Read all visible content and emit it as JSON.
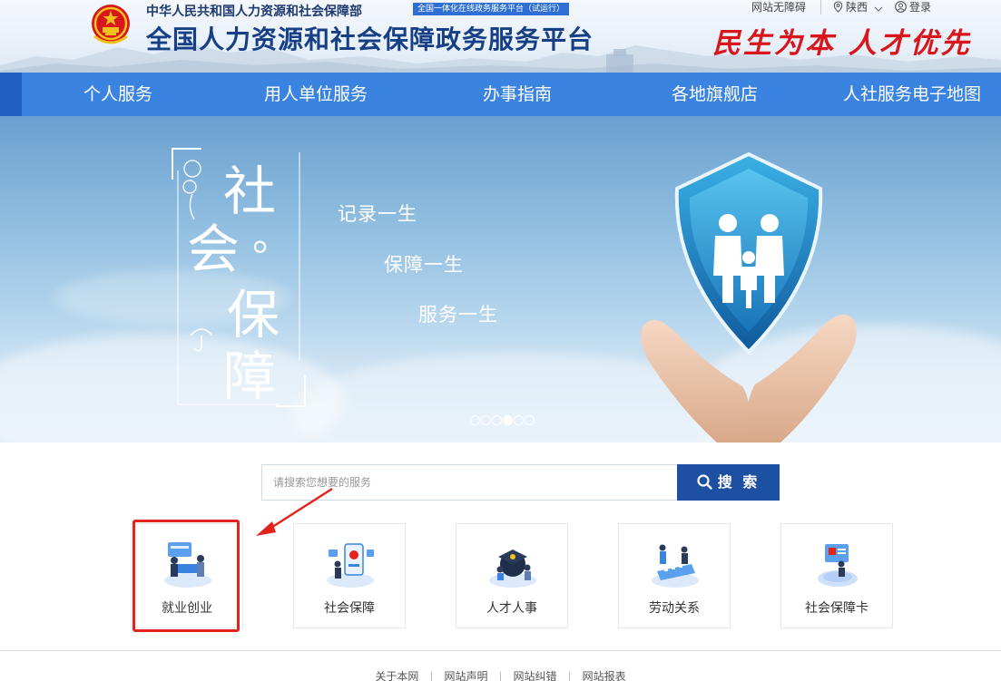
{
  "header": {
    "ministry": "中华人民共和国人力资源和社会保障部",
    "beta_tag": "全国一体化在线政务服务平台（试运行）",
    "platform_title": "全国人力资源和社会保障政务服务平台",
    "slogan": "民生为本 人才优先",
    "accessibility": "网站无障碍",
    "region": "陕西",
    "login": "登录"
  },
  "nav": {
    "items": [
      "个人服务",
      "用人单位服务",
      "办事指南",
      "各地旗舰店",
      "人社服务电子地图"
    ]
  },
  "banner": {
    "chars": [
      "社",
      "会",
      "。",
      "保",
      "障"
    ],
    "phrases": [
      "记录一生",
      "保障一生",
      "服务一生"
    ],
    "active_slide": 4,
    "slide_count": 6
  },
  "search": {
    "placeholder": "请搜索您想要的服务",
    "button_label": "搜 索"
  },
  "services": [
    {
      "label": "就业创业",
      "highlighted": true
    },
    {
      "label": "社会保障",
      "highlighted": false
    },
    {
      "label": "人才人事",
      "highlighted": false
    },
    {
      "label": "劳动关系",
      "highlighted": false
    },
    {
      "label": "社会保障卡",
      "highlighted": false
    }
  ],
  "footer": {
    "links": [
      "关于本网",
      "网站声明",
      "网站纠错",
      "网站报表"
    ]
  },
  "colors": {
    "nav_blue": "#3a83e0",
    "title_navy": "#163f86",
    "slogan_red": "#d8161b",
    "search_button": "#1d4fa3",
    "highlight_red": "#e3231c"
  }
}
